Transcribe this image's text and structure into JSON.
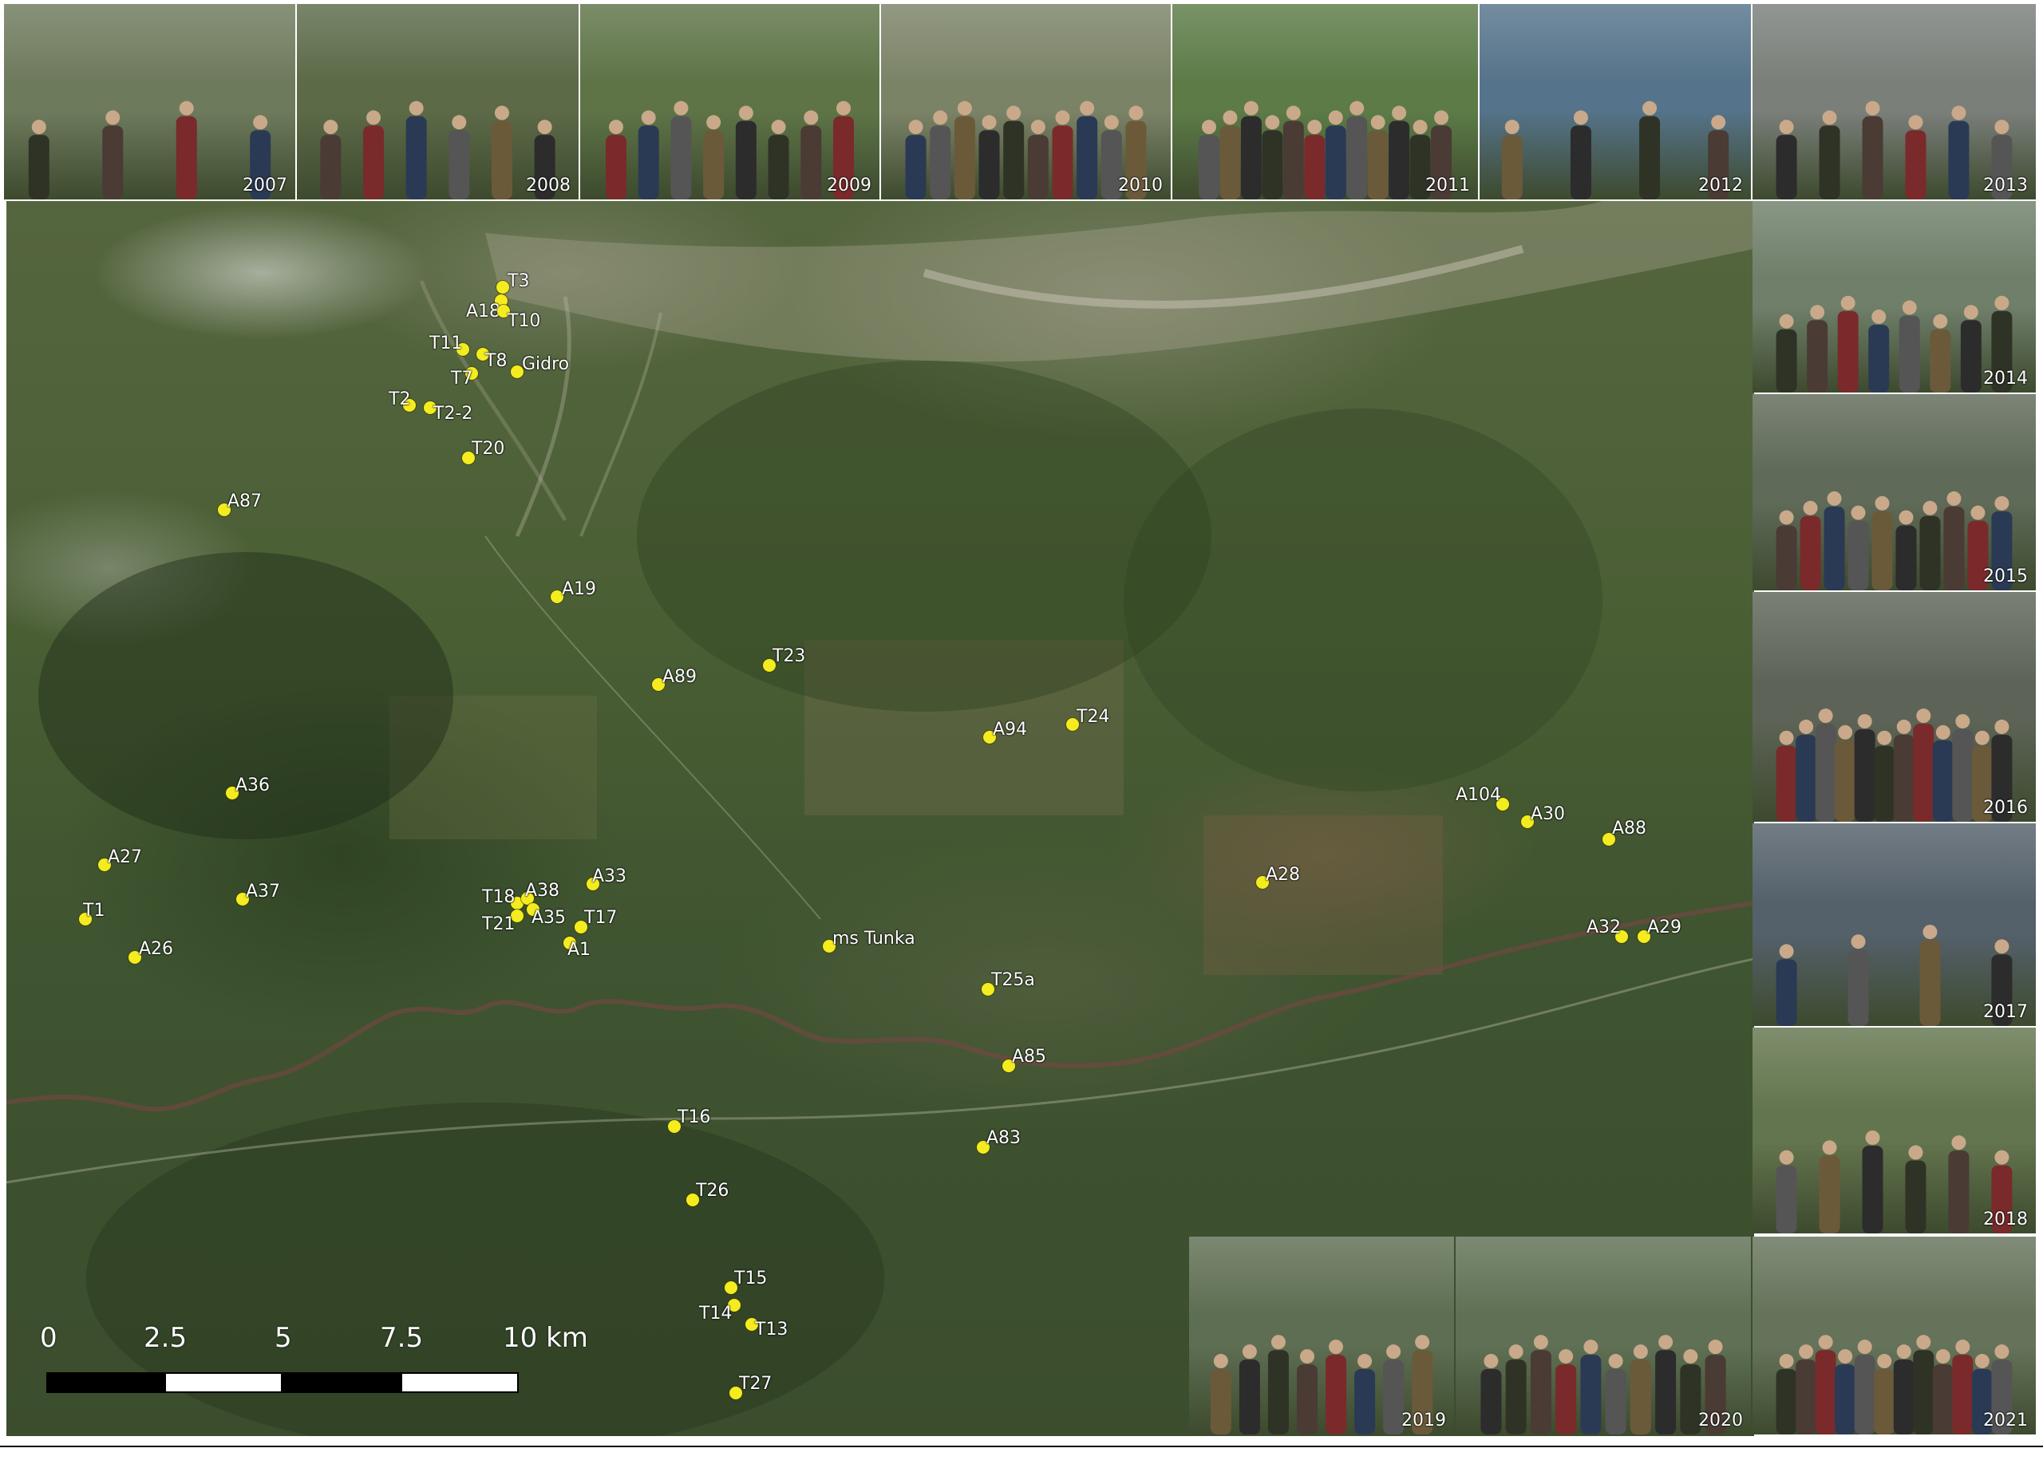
{
  "points": [
    {
      "label": "T3"
    },
    {
      "label": "A18"
    },
    {
      "label": "T10"
    },
    {
      "label": "T11"
    },
    {
      "label": "T8"
    },
    {
      "label": "Gidro"
    },
    {
      "label": "T7"
    },
    {
      "label": "T2"
    },
    {
      "label": "T2-2"
    },
    {
      "label": "T20"
    },
    {
      "label": "A87"
    },
    {
      "label": "A19"
    },
    {
      "label": "A89"
    },
    {
      "label": "T23"
    },
    {
      "label": "A94"
    },
    {
      "label": "T24"
    },
    {
      "label": "A36"
    },
    {
      "label": "A27"
    },
    {
      "label": "A37"
    },
    {
      "label": "T1"
    },
    {
      "label": "A26"
    },
    {
      "label": "T18"
    },
    {
      "label": "A38"
    },
    {
      "label": "A33"
    },
    {
      "label": "T21"
    },
    {
      "label": "A35"
    },
    {
      "label": "T17"
    },
    {
      "label": "A1"
    },
    {
      "label": "ms Tunka"
    },
    {
      "label": "A28"
    },
    {
      "label": "A104"
    },
    {
      "label": "A30"
    },
    {
      "label": "A88"
    },
    {
      "label": "A32"
    },
    {
      "label": "A29"
    },
    {
      "label": "T25a"
    },
    {
      "label": "A85"
    },
    {
      "label": "T16"
    },
    {
      "label": "A83"
    },
    {
      "label": "T26"
    },
    {
      "label": "T15"
    },
    {
      "label": "T14"
    },
    {
      "label": "T13"
    },
    {
      "label": "T27"
    }
  ],
  "scale_bar": {
    "ticks": [
      "0",
      "2.5",
      "5",
      "7.5",
      "10 km"
    ],
    "colors": [
      "#000000",
      "#ffffff",
      "#000000",
      "#ffffff"
    ]
  },
  "photos": [
    {
      "year": "2007",
      "tint": "#6e7a5c"
    },
    {
      "year": "2008",
      "tint": "#5c6a48"
    },
    {
      "year": "2009",
      "tint": "#5e7447"
    },
    {
      "year": "2010",
      "tint": "#7b8367"
    },
    {
      "year": "2011",
      "tint": "#5c7b47"
    },
    {
      "year": "2012",
      "tint": "#55738a"
    },
    {
      "year": "2013",
      "tint": "#7a7f7a"
    },
    {
      "year": "2014",
      "tint": "#6f7f6a"
    },
    {
      "year": "2015",
      "tint": "#5f6a58"
    },
    {
      "year": "2016",
      "tint": "#5d6457"
    },
    {
      "year": "2017",
      "tint": "#54606a"
    },
    {
      "year": "2018",
      "tint": "#63754e"
    },
    {
      "year": "2019",
      "tint": "#5e6e52"
    },
    {
      "year": "2020",
      "tint": "#5f7054"
    },
    {
      "year": "2021",
      "tint": "#65735a"
    }
  ],
  "colors": {
    "point": "#f4ec1f",
    "label": "#ffffff"
  }
}
